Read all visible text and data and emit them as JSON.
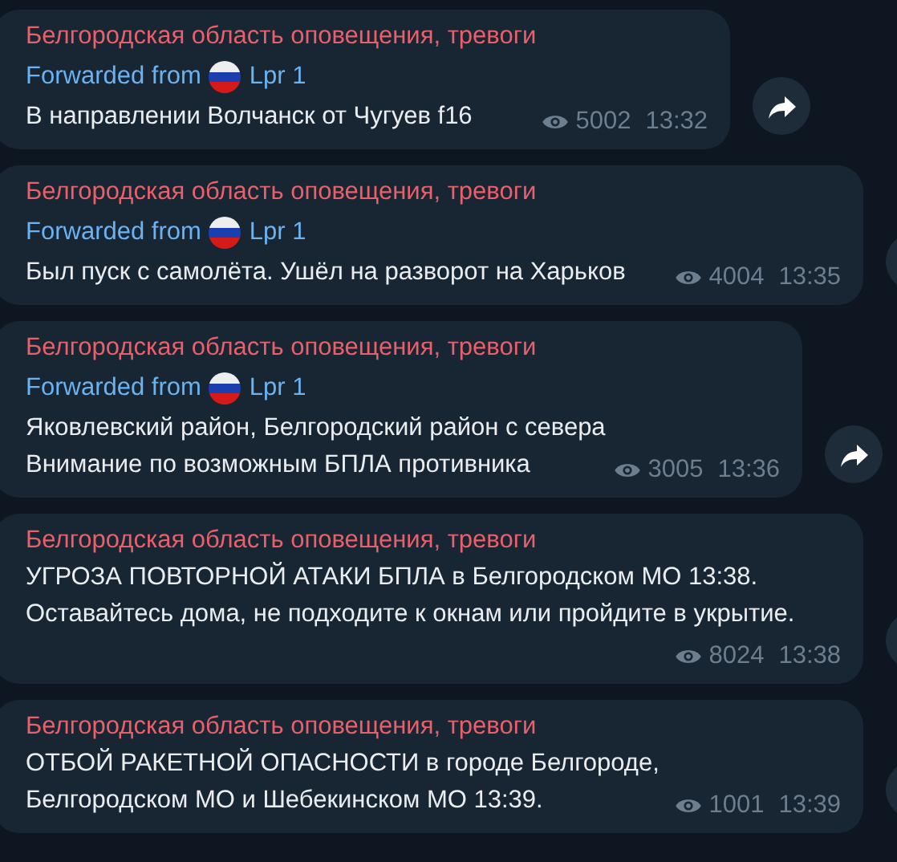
{
  "messages": [
    {
      "channel": "Белгородская область оповещения, тревоги",
      "forwarded_label": "Forwarded from",
      "forwarded_source": "Lpr 1",
      "lines": [
        "В направлении Волчанск от Чугуев f16"
      ],
      "views": "5002",
      "time": "13:32",
      "share_button": true,
      "share_button_cut": false
    },
    {
      "channel": "Белгородская область оповещения, тревоги",
      "forwarded_label": "Forwarded from",
      "forwarded_source": "Lpr 1",
      "lines": [
        "Был пуск с самолёта. Ушёл на разворот на Харьков"
      ],
      "views": "4004",
      "time": "13:35",
      "share_button": true,
      "share_button_cut": true
    },
    {
      "channel": "Белгородская область оповещения, тревоги",
      "forwarded_label": "Forwarded from",
      "forwarded_source": "Lpr 1",
      "lines": [
        "Яковлевский район, Белгородский район с севера",
        "Внимание по возможным БПЛА противника"
      ],
      "views": "3005",
      "time": "13:36",
      "share_button": true,
      "share_button_cut": false
    },
    {
      "channel": "Белгородская область оповещения, тревоги",
      "lines": [
        "УГРОЗА ПОВТОРНОЙ АТАКИ БПЛА в  Белгородском МО 13:38.",
        "Оставайтесь дома, не подходите к окнам или пройдите в укрытие."
      ],
      "views": "8024",
      "time": "13:38",
      "share_button": true,
      "share_button_cut": true
    },
    {
      "channel": "Белгородская область оповещения, тревоги",
      "lines": [
        "ОТБОЙ РАКЕТНОЙ ОПАСНОСТИ в городе Белгороде,",
        "Белгородском МО и Шебекинском МО 13:39."
      ],
      "views": "1001",
      "time": "13:39",
      "share_button": true,
      "share_button_cut": true
    }
  ]
}
